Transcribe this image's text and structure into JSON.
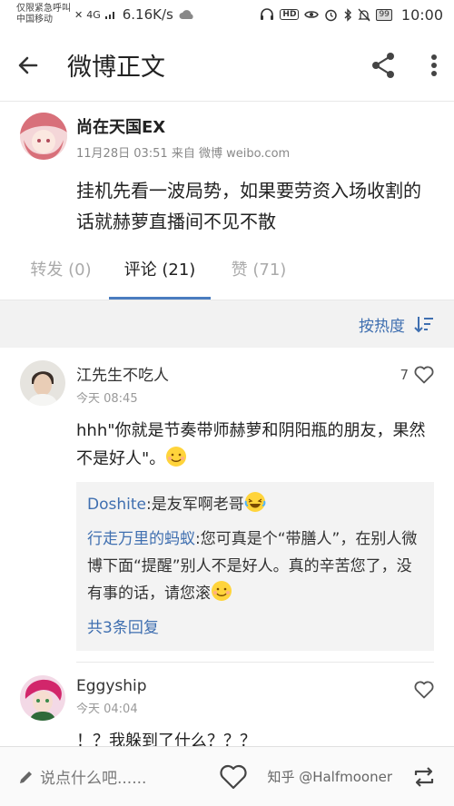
{
  "statusbar": {
    "carrier_line1": "仅限紧急呼叫",
    "carrier_line2": "中国移动",
    "network": "4G",
    "speed": "6.16K/s",
    "battery": "99",
    "time": "10:00"
  },
  "appbar": {
    "title": "微博正文",
    "back_icon": "arrow-left-icon",
    "share_icon": "share-icon",
    "more_icon": "more-vert-icon"
  },
  "post": {
    "author": "尚在天国EX",
    "time_source": "11月28日 03:51 来自 微博 weibo.com",
    "text": "挂机先看一波局势，如果要劳资入场收割的话就赫萝直播间不见不散"
  },
  "tabs": [
    {
      "label": "转发 (0)"
    },
    {
      "label": "评论 (21)",
      "active": true
    },
    {
      "label": "赞 (71)"
    }
  ],
  "sort": {
    "label": "按热度"
  },
  "comments": [
    {
      "name": "江先生不吃人",
      "time": "今天 08:45",
      "likes": "7",
      "text": "hhh\"你就是节奏带师赫萝和阴阳瓶的朋友，果然不是好人\"。",
      "replies": [
        {
          "user": "Doshite",
          "text": ":是友军啊老哥"
        },
        {
          "user": "行走万里的蚂蚁",
          "text": ":您可真是个“带膳人”，在别人微博下面“提醒”别人不是好人。真的辛苦您了，没有事的话，请您滚"
        }
      ],
      "more_replies": "共3条回复"
    },
    {
      "name": "Eggyship",
      "time": "今天 04:04",
      "likes": "",
      "text": "！？我躲到了什么？？？"
    }
  ],
  "bottombar": {
    "placeholder": "说点什么吧......",
    "watermark": "知乎 @Halfmooner"
  },
  "colors": {
    "link": "#3f6fb0",
    "tab_underline": "#4a7cbf"
  }
}
